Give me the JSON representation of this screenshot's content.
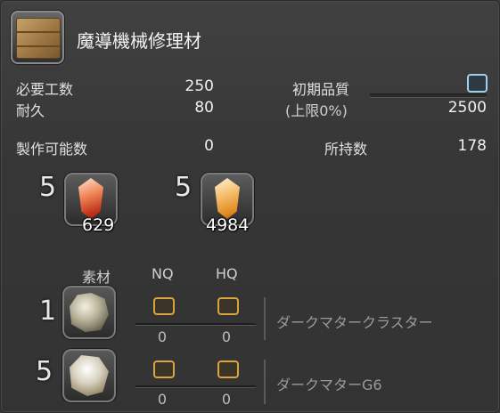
{
  "item": {
    "name": "魔導機械修理材",
    "icon": "wooden-crate-icon"
  },
  "stats": {
    "required_craftsmanship_label": "必要工数",
    "required_craftsmanship_value": "250",
    "durability_label": "耐久",
    "durability_value": "80",
    "initial_quality_label": "初期品質",
    "quality_cap_label": "(上限0%)",
    "quality_max_value": "2500",
    "craftable_label": "製作可能数",
    "craftable_value": "0",
    "owned_label": "所持数",
    "owned_value": "178"
  },
  "crystals": [
    {
      "required": "5",
      "owned": "629",
      "icon": "fire-crystal-icon"
    },
    {
      "required": "5",
      "owned": "4984",
      "icon": "lightning-crystal-icon"
    }
  ],
  "materials_table": {
    "col_material": "素材",
    "col_nq": "NQ",
    "col_hq": "HQ",
    "rows": [
      {
        "required": "1",
        "name": "ダークマタークラスター",
        "nq": "0",
        "hq": "0",
        "icon": "dark-matter-cluster-icon"
      },
      {
        "required": "5",
        "name": "ダークマターG6",
        "nq": "0",
        "hq": "0",
        "icon": "dark-matter-g6-icon"
      }
    ]
  },
  "colors": {
    "accent_quality": "#9fd0ee",
    "checkbox": "#d9a441"
  }
}
